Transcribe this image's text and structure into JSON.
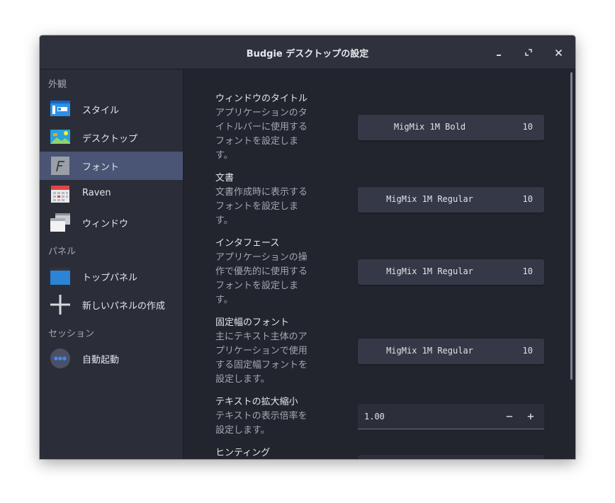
{
  "window": {
    "title": "Budgie デスクトップの設定"
  },
  "sidebar": {
    "sections": [
      {
        "label": "外観"
      },
      {
        "label": "パネル"
      },
      {
        "label": "セッション"
      }
    ],
    "items": [
      {
        "label": "スタイル",
        "icon": "style-icon"
      },
      {
        "label": "デスクトップ",
        "icon": "desktop-icon"
      },
      {
        "label": "フォント",
        "icon": "font-icon",
        "selected": true
      },
      {
        "label": "Raven",
        "icon": "calendar-icon"
      },
      {
        "label": "ウィンドウ",
        "icon": "windows-icon"
      },
      {
        "label": "トップパネル",
        "icon": "top-panel-icon"
      },
      {
        "label": "新しいパネルの作成",
        "icon": "add-icon"
      },
      {
        "label": "自動起動",
        "icon": "autostart-icon"
      }
    ]
  },
  "settings": [
    {
      "title": "ウィンドウのタイトル",
      "description": "アプリケーションのタイトルバーに使用するフォントを設定します。",
      "font": "MigMix 1M Bold",
      "size": "10"
    },
    {
      "title": "文書",
      "description": "文書作成時に表示するフォントを設定します。",
      "font": "MigMix 1M Regular",
      "size": "10"
    },
    {
      "title": "インタフェース",
      "description": "アプリケーションの操作で優先的に使用するフォントを設定します。",
      "font": "MigMix 1M Regular",
      "size": "10"
    },
    {
      "title": "固定幅のフォント",
      "description": "主にテキスト主体のアプリケーションで使用する固定幅フォントを設定します。",
      "font": "MigMix 1M Regular",
      "size": "10"
    },
    {
      "title": "テキストの拡大縮小",
      "description": "テキストの表示倍率を設定します。",
      "value": "1.00",
      "minus": "−",
      "plus": "+"
    },
    {
      "title": "ヒンティング"
    }
  ],
  "colors": {
    "accent": "#4a5474",
    "background": "#23252e",
    "sidebar": "#2b2e38"
  }
}
